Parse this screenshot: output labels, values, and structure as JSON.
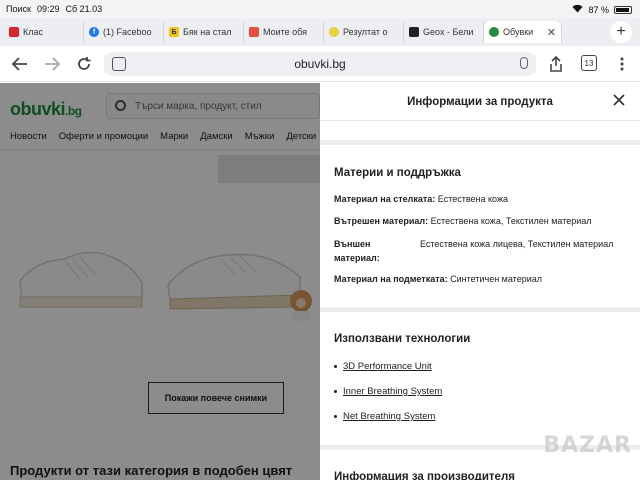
{
  "status_bar": {
    "back_label": "Поиск",
    "time": "09:29",
    "date": "Сб 21.03",
    "battery": "87 %"
  },
  "tabs": [
    {
      "label": "Клас",
      "favicon": "red-circle"
    },
    {
      "label": "(1) Faceboo",
      "favicon": "facebook-icon"
    },
    {
      "label": "Бяк на стал",
      "favicon": "yellow-icon"
    },
    {
      "label": "Моите обя",
      "favicon": "red-icon"
    },
    {
      "label": "Резултат о",
      "favicon": "yellow-circle"
    },
    {
      "label": "Geox - Бели",
      "favicon": "geox-icon"
    },
    {
      "label": "Обувки",
      "favicon": "obuvki-icon"
    }
  ],
  "address_bar": {
    "url": "obuvki.bg"
  },
  "toolbar": {
    "tab_count": "13"
  },
  "page": {
    "logo_main": "obuvki",
    "logo_tld": ".bg",
    "search_placeholder": "Търси марка, продукт, стил",
    "menu": [
      "Новости",
      "Оферти и промоции",
      "Марки",
      "Дамски",
      "Мъжки",
      "Детски"
    ],
    "show_more": "Покажи повече снимки",
    "similar_heading": "Продукти от тази категория в подобен цвят"
  },
  "panel": {
    "title": "Информации за продукта",
    "materials": {
      "heading": "Материи и поддръжка",
      "rows": [
        {
          "key": "Материал на стелката:",
          "value": "Естествена кожа"
        },
        {
          "key": "Вътрешен материал:",
          "value": "Естествена кожа, Текстилен материал"
        },
        {
          "key": "Външен материал:",
          "value": "Естествена кожа лицева, Текстилен материал"
        },
        {
          "key": "Материал на подметката:",
          "value": "Синтетичен материал"
        }
      ]
    },
    "technologies": {
      "heading": "Използвани технологии",
      "items": [
        "3D Performance Unit",
        "Inner Breathing System",
        "Net Breathing System"
      ]
    },
    "manufacturer_heading": "Информация за производителя"
  },
  "watermark": "BAZAR",
  "colors": {
    "brand_green": "#1e8f3c",
    "overlay": "#000000"
  }
}
